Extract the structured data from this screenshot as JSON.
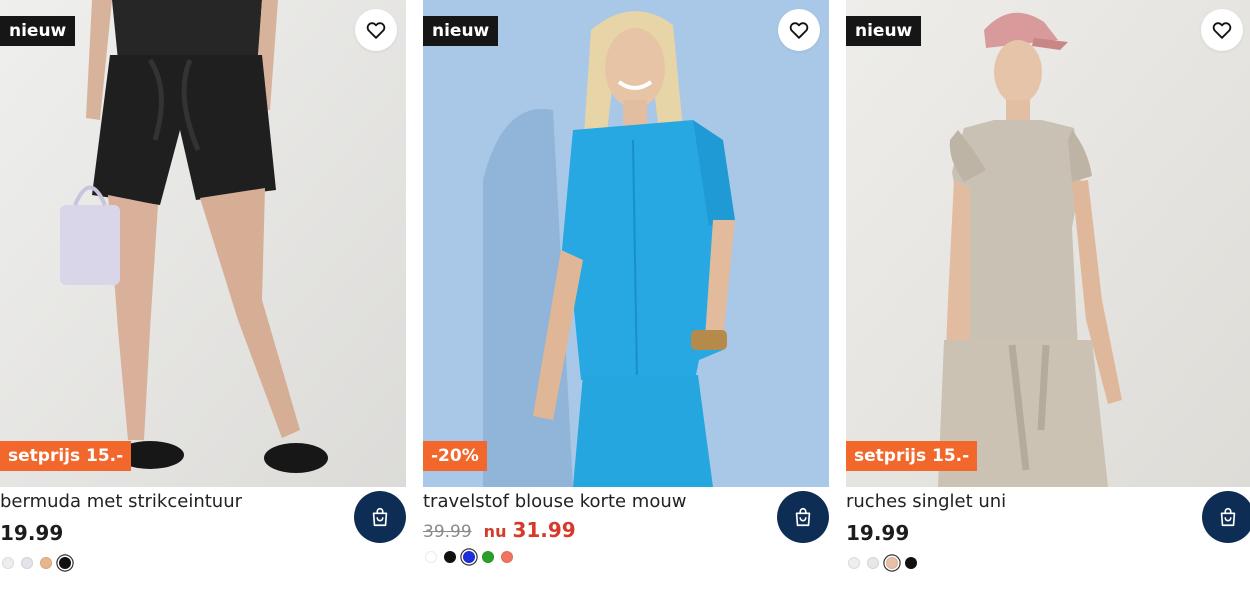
{
  "products": [
    {
      "badge": "nieuw",
      "promo": "setprijs 15.-",
      "title": "bermuda met strikceintuur",
      "price": "19.99",
      "swatches": [
        {
          "color": "#eeeeee",
          "selected": false
        },
        {
          "color": "#e3e3ea",
          "selected": false
        },
        {
          "color": "#e8b68b",
          "selected": false
        },
        {
          "color": "#111111",
          "selected": true
        }
      ]
    },
    {
      "badge": "nieuw",
      "promo": "-20%",
      "title": "travelstof blouse korte mouw",
      "old_price": "39.99",
      "now_label": "nu",
      "price": "31.99",
      "swatches": [
        {
          "color": "#ffffff",
          "selected": false
        },
        {
          "color": "#111111",
          "selected": false
        },
        {
          "color": "#1b2fe0",
          "selected": true
        },
        {
          "color": "#2aa02a",
          "selected": false
        },
        {
          "color": "#f07560",
          "selected": false
        }
      ]
    },
    {
      "badge": "nieuw",
      "promo": "setprijs 15.-",
      "title": "ruches singlet uni",
      "price": "19.99",
      "swatches": [
        {
          "color": "#eeeeee",
          "selected": false
        },
        {
          "color": "#e7e7e7",
          "selected": false
        },
        {
          "color": "#e9bfa5",
          "selected": true
        },
        {
          "color": "#111111",
          "selected": false
        }
      ]
    }
  ],
  "colors": {
    "badge_bg": "#161616",
    "promo_bg": "#f2672c",
    "cart_bg": "#0e2d55",
    "sale_price": "#d63a2a"
  },
  "icons": {
    "favorite": "heart-icon",
    "cart": "shopping-bag-icon"
  }
}
